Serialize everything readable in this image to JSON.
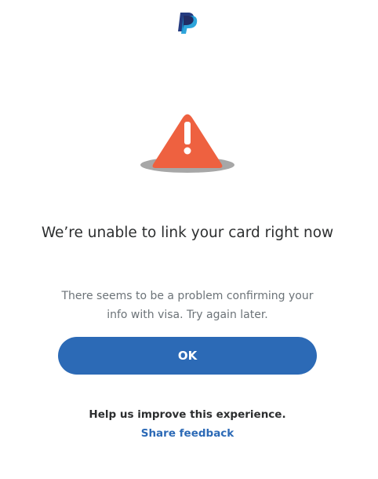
{
  "header": {
    "logo_icon": "paypal-logo-icon"
  },
  "alert": {
    "icon": "warning-triangle-icon",
    "icon_color": "#EE6140",
    "title": "We’re unable to link your card right now",
    "message": "There seems to be a problem confirming your info with visa. Try again later."
  },
  "actions": {
    "ok_label": "OK",
    "button_color": "#2C6AB6"
  },
  "feedback": {
    "prompt": "Help us improve this experience.",
    "link_label": "Share feedback"
  }
}
